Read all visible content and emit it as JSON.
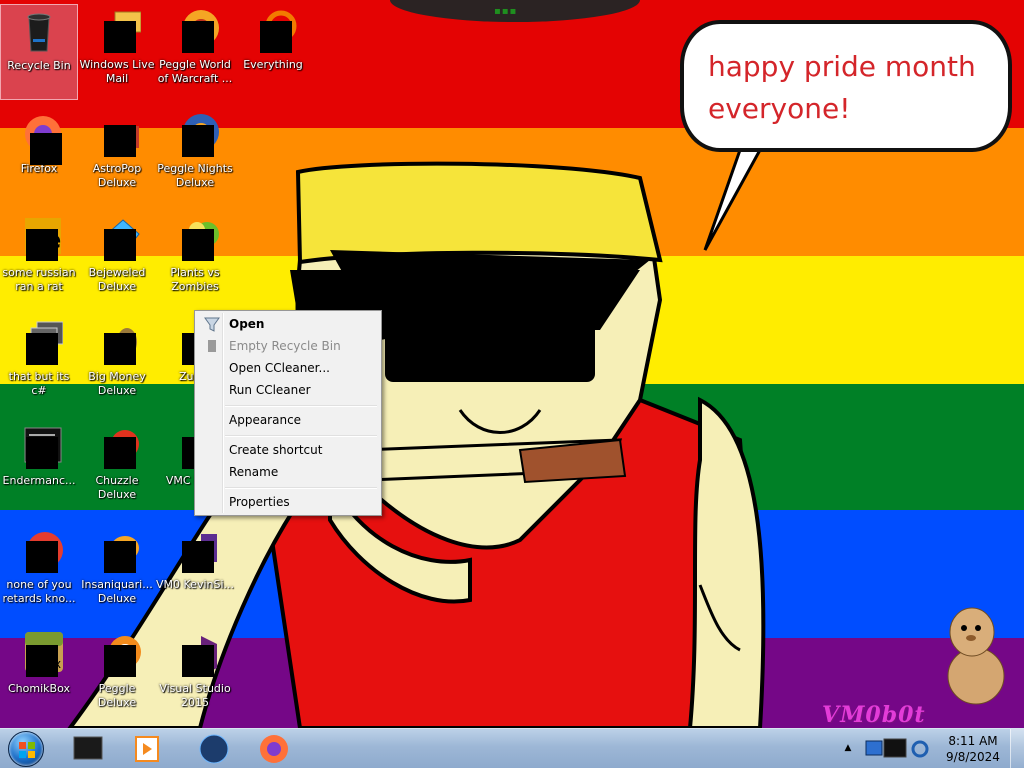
{
  "wallpaper": {
    "stripes": [
      "#e40303",
      "#ff8c00",
      "#ffed00",
      "#008026",
      "#004dff",
      "#750787"
    ],
    "speech_bubble": "happy pride month everyone!",
    "watermark": "VM0b0t"
  },
  "desktop_icons": [
    {
      "label": "Recycle Bin",
      "icon": "recycle-bin-icon",
      "selected": true
    },
    {
      "label": "Windows Live Mail",
      "icon": "windows-live-mail-icon"
    },
    {
      "label": "Peggle World of Warcraft ...",
      "icon": "peggle-wow-icon"
    },
    {
      "label": "Everything",
      "icon": "everything-search-icon"
    },
    {
      "label": "Firefox",
      "icon": "firefox-icon"
    },
    {
      "label": "AstroPop Deluxe",
      "icon": "astropop-icon"
    },
    {
      "label": "Peggle Nights Deluxe",
      "icon": "peggle-nights-icon"
    },
    {
      "label": "some russian ran a rat",
      "icon": "russian-rat-icon"
    },
    {
      "label": "Bejeweled Deluxe",
      "icon": "bejeweled-icon"
    },
    {
      "label": "Plants vs Zombies",
      "icon": "plants-vs-zombies-icon"
    },
    {
      "label": "that but its c#",
      "icon": "stacked-windows-icon"
    },
    {
      "label": "Big Money Deluxe",
      "icon": "big-money-icon"
    },
    {
      "label": "Zuma",
      "icon": "zuma-icon"
    },
    {
      "label": "Endermanc...",
      "icon": "console-app-icon"
    },
    {
      "label": "Chuzzle Deluxe",
      "icon": "chuzzle-icon"
    },
    {
      "label": "VMC Kevin",
      "icon": "vm-kevin-icon"
    },
    {
      "label": "none of you retards kno...",
      "icon": "red-orb-icon"
    },
    {
      "label": "Insaniquari... Deluxe",
      "icon": "insaniquarium-icon"
    },
    {
      "label": "VM0 KevinSi...",
      "icon": "vm-kevinsi-icon"
    },
    {
      "label": "ChomikBox",
      "icon": "chomikbox-icon"
    },
    {
      "label": "Peggle Deluxe",
      "icon": "peggle-deluxe-icon"
    },
    {
      "label": "Visual Studio 2015",
      "icon": "visual-studio-icon"
    }
  ],
  "context_menu": {
    "items": [
      {
        "label": "Open",
        "bold": true,
        "icon": "recycle-bin-empty-icon"
      },
      {
        "label": "Empty Recycle Bin",
        "disabled": true,
        "icon": "recycle-bin-small-icon"
      },
      {
        "label": "Open CCleaner..."
      },
      {
        "label": "Run CCleaner"
      },
      {
        "label": "Appearance"
      },
      {
        "label": "Create shortcut"
      },
      {
        "label": "Rename"
      },
      {
        "label": "Properties"
      }
    ]
  },
  "taskbar": {
    "start_button": "windows-start-orb-icon",
    "pinned": [
      {
        "name": "vm-app-pinned",
        "icon": "vm-screen-icon"
      },
      {
        "name": "media-player-pinned",
        "icon": "media-player-icon"
      },
      {
        "name": "globe-app-pinned",
        "icon": "globe-icon"
      },
      {
        "name": "firefox-pinned",
        "icon": "firefox-icon"
      }
    ],
    "tray_icons": [
      "network-icon",
      "monitor-icon",
      "sync-icon"
    ],
    "clock": {
      "time": "8:11 AM",
      "date": "9/8/2024"
    }
  }
}
